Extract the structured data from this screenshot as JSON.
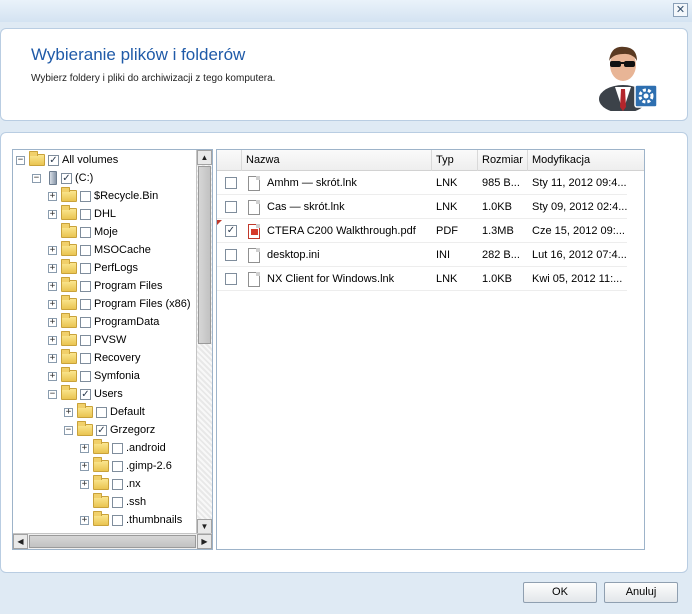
{
  "header": {
    "title": "Wybieranie plików i folderów",
    "subtitle": "Wybierz foldery i pliki do archiwizacji z tego komputera."
  },
  "tree": {
    "nodes": [
      {
        "label": "All volumes",
        "depth": 0,
        "expander": "−",
        "icon": "folder",
        "checked": true
      },
      {
        "label": "(C:)",
        "depth": 1,
        "expander": "−",
        "icon": "drive",
        "checked": true
      },
      {
        "label": "$Recycle.Bin",
        "depth": 2,
        "expander": "+",
        "icon": "folder",
        "checked": false
      },
      {
        "label": "DHL",
        "depth": 2,
        "expander": "+",
        "icon": "folder",
        "checked": false
      },
      {
        "label": "Moje",
        "depth": 2,
        "expander": "",
        "icon": "folder",
        "checked": false
      },
      {
        "label": "MSOCache",
        "depth": 2,
        "expander": "+",
        "icon": "folder",
        "checked": false
      },
      {
        "label": "PerfLogs",
        "depth": 2,
        "expander": "+",
        "icon": "folder",
        "checked": false
      },
      {
        "label": "Program Files",
        "depth": 2,
        "expander": "+",
        "icon": "folder",
        "checked": false
      },
      {
        "label": "Program Files (x86)",
        "depth": 2,
        "expander": "+",
        "icon": "folder",
        "checked": false
      },
      {
        "label": "ProgramData",
        "depth": 2,
        "expander": "+",
        "icon": "folder",
        "checked": false
      },
      {
        "label": "PVSW",
        "depth": 2,
        "expander": "+",
        "icon": "folder",
        "checked": false
      },
      {
        "label": "Recovery",
        "depth": 2,
        "expander": "+",
        "icon": "folder",
        "checked": false
      },
      {
        "label": "Symfonia",
        "depth": 2,
        "expander": "+",
        "icon": "folder",
        "checked": false
      },
      {
        "label": "Users",
        "depth": 2,
        "expander": "−",
        "icon": "folder",
        "checked": true
      },
      {
        "label": "Default",
        "depth": 3,
        "expander": "+",
        "icon": "folder",
        "checked": false
      },
      {
        "label": "Grzegorz",
        "depth": 3,
        "expander": "−",
        "icon": "folder",
        "checked": true
      },
      {
        "label": ".android",
        "depth": 4,
        "expander": "+",
        "icon": "folder",
        "checked": false
      },
      {
        "label": ".gimp-2.6",
        "depth": 4,
        "expander": "+",
        "icon": "folder",
        "checked": false
      },
      {
        "label": ".nx",
        "depth": 4,
        "expander": "+",
        "icon": "folder",
        "checked": false
      },
      {
        "label": ".ssh",
        "depth": 4,
        "expander": "",
        "icon": "folder",
        "checked": false
      },
      {
        "label": ".thumbnails",
        "depth": 4,
        "expander": "+",
        "icon": "folder",
        "checked": false
      }
    ]
  },
  "list": {
    "columns": [
      "Nazwa",
      "Typ",
      "Rozmiar",
      "Modyfikacja"
    ],
    "rows": [
      {
        "name": "Amhm — skrót.lnk",
        "type": "LNK",
        "size": "985 B...",
        "modified": "Sty 11, 2012 09:4...",
        "checked": false,
        "icon": "file"
      },
      {
        "name": "Cas — skrót.lnk",
        "type": "LNK",
        "size": "1.0KB",
        "modified": "Sty 09, 2012 02:4...",
        "checked": false,
        "icon": "file"
      },
      {
        "name": "CTERA C200 Walkthrough.pdf",
        "type": "PDF",
        "size": "1.3MB",
        "modified": "Cze 15, 2012 09:...",
        "checked": true,
        "icon": "pdf"
      },
      {
        "name": "desktop.ini",
        "type": "INI",
        "size": "282 B...",
        "modified": "Lut 16, 2012 07:4...",
        "checked": false,
        "icon": "file"
      },
      {
        "name": "NX Client for Windows.lnk",
        "type": "LNK",
        "size": "1.0KB",
        "modified": "Kwi 05, 2012 11:...",
        "checked": false,
        "icon": "file"
      }
    ]
  },
  "buttons": {
    "ok": "OK",
    "cancel": "Anuluj"
  },
  "icons": {
    "close": "close-icon",
    "check": "✓"
  }
}
